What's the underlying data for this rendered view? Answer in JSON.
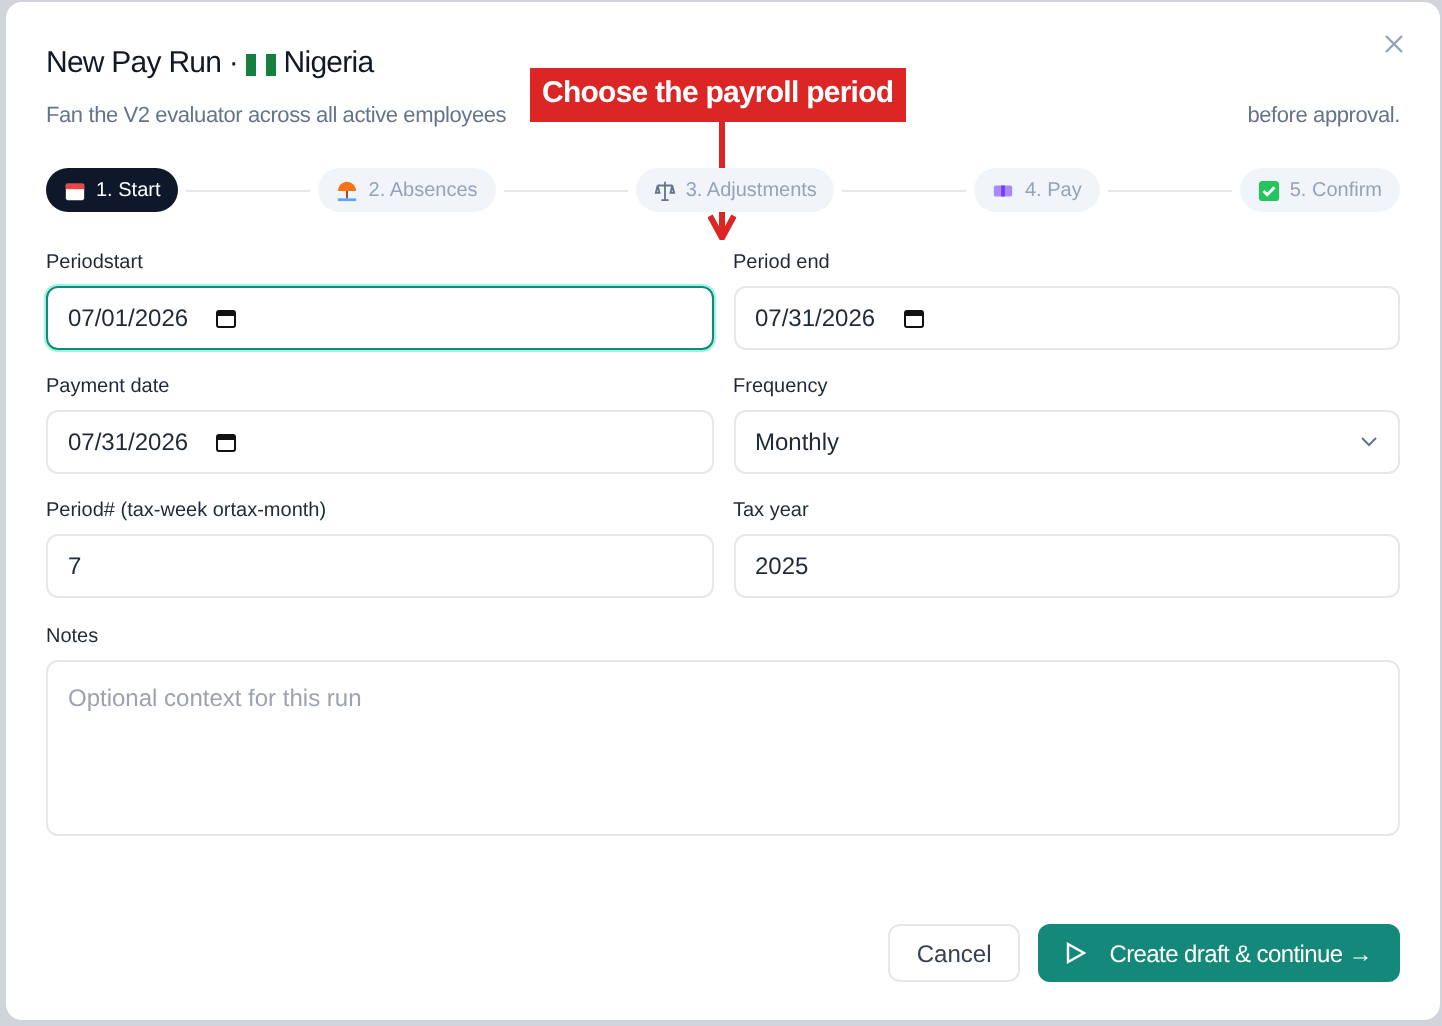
{
  "dialog": {
    "title": "New Pay Run · ",
    "country": "Nigeria",
    "subtitle_start": "Fan the V2 evaluator across all active employees",
    "subtitle_end": "before approval."
  },
  "callout": {
    "text": "Choose the payroll period"
  },
  "steps": [
    {
      "label": "1. Start",
      "selected": true,
      "kind": "calendar"
    },
    {
      "label": "2. Absences",
      "selected": false,
      "kind": "beach"
    },
    {
      "label": "3. Adjustments",
      "selected": false,
      "kind": "scales"
    },
    {
      "label": "4. Pay",
      "selected": false,
      "kind": "money"
    },
    {
      "label": "5. Confirm",
      "selected": false,
      "kind": "check"
    }
  ],
  "fields": [
    {
      "label": "Periodstart",
      "value": "07/01/2026",
      "kind": "date",
      "focused": true
    },
    {
      "label": "Period end",
      "value": "07/31/2026",
      "kind": "date",
      "focused": false
    },
    {
      "label": "Payment date",
      "value": "07/31/2026",
      "kind": "date",
      "focused": false
    },
    {
      "label": "Frequency",
      "value": "Monthly",
      "kind": "select",
      "focused": false
    },
    {
      "label": "Period# (tax-week ortax-month)",
      "value": "7",
      "kind": "text",
      "focused": false
    },
    {
      "label": "Tax year",
      "value": "2025",
      "kind": "text",
      "focused": false
    }
  ],
  "notes": {
    "label": "Notes",
    "placeholder": "Optional context for this run"
  },
  "buttons": {
    "cancel": "Cancel",
    "primary": "Create draft & continue →"
  }
}
